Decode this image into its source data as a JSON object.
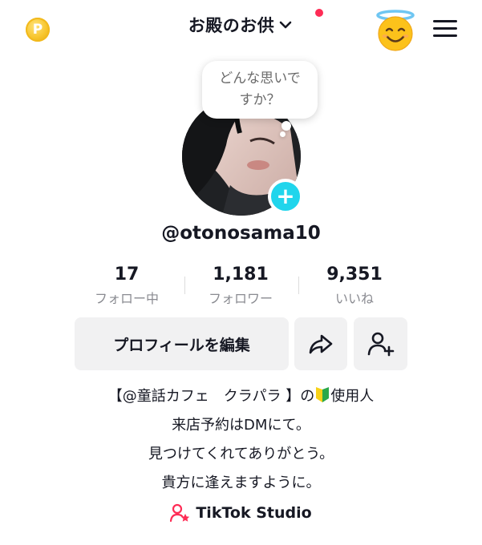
{
  "header": {
    "coin_icon": "coin-icon",
    "coin_letter": "P",
    "title": "お殿のお供",
    "notification_color": "#fe2c55",
    "emoji_icon": "smiling-face-with-halo-icon",
    "menu_icon": "hamburger-menu-icon"
  },
  "bubble": {
    "line1": "どんな思いで",
    "line2": "すか？"
  },
  "profile": {
    "username": "@otonosama10",
    "add_button_color": "#20d5ec"
  },
  "stats": [
    {
      "value": "17",
      "label": "フォロー中"
    },
    {
      "value": "1,181",
      "label": "フォロワー"
    },
    {
      "value": "9,351",
      "label": "いいね"
    }
  ],
  "actions": {
    "edit_label": "プロフィールを編集",
    "share_icon": "share-icon",
    "add_friend_icon": "add-friend-icon"
  },
  "bio": {
    "line1_before": "【@童話カフェ　クラパラ 】の",
    "line1_badge": "beginner-mark-icon",
    "line1_after": "使用人",
    "line2": "来店予約はDMにて。",
    "line3": "見つけてくれてありがとう。",
    "line4": "貴方に逢えますように。"
  },
  "studio": {
    "label": "TikTok Studio",
    "icon": "person-star-icon",
    "icon_color": "#fe2c55"
  }
}
